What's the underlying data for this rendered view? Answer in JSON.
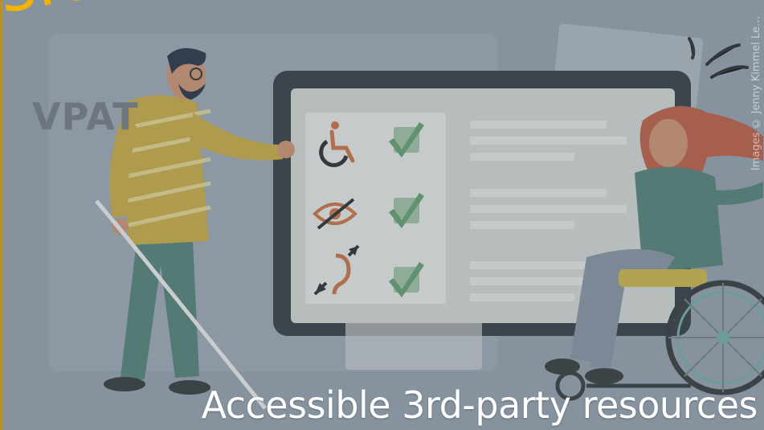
{
  "overlay_text": {
    "corner_fragment": "sic",
    "vpat": "VPAT"
  },
  "caption": "Accessible 3rd-party resources",
  "credit": "Images © Jenny Kimmel Le…",
  "icons": [
    "wheelchair-icon",
    "eye-slash-icon",
    "hearing-icon",
    "checkmark-icon",
    "cane-icon"
  ],
  "colors": {
    "background": "#8e9aa6",
    "accent_orange": "#f0b400",
    "caption_text": "#ffffff",
    "check_green": "#5b9a67",
    "monitor_frame": "#2c3338",
    "screen": "#e7e6e1"
  }
}
